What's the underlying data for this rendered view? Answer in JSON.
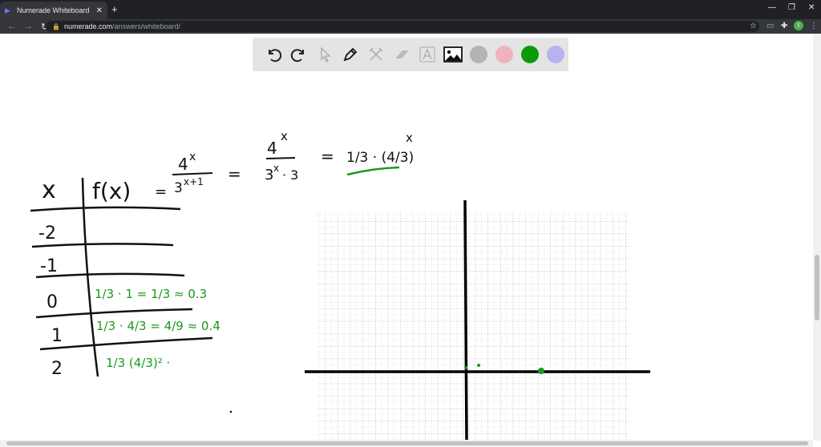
{
  "browser": {
    "tab_title": "Numerade Whiteboard",
    "url_host": "numerade.com",
    "url_path": "/answers/whiteboard/",
    "avatar_letter": "I"
  },
  "toolbar": {
    "tools": [
      "undo-icon",
      "redo-icon",
      "select-icon",
      "pen-icon",
      "tools-icon",
      "eraser-icon",
      "text-icon",
      "image-icon"
    ],
    "colors": [
      "#b3b3b3",
      "#f0b3bb",
      "#0a9a0a",
      "#b8b3ee"
    ]
  },
  "whiteboard": {
    "equation": {
      "lhs": "f(x)",
      "eq": "=",
      "frac1_num": "4",
      "frac1_num_exp": "x",
      "frac1_den": "3",
      "frac1_den_exp": "x+1",
      "frac2_num": "4",
      "frac2_num_exp": "x",
      "frac2_den": "3",
      "frac2_den_exp": "x",
      "frac2_den_tail": "· 3",
      "result": "1/3 · (4/3)",
      "result_exp": "x"
    },
    "table": {
      "header_x": "x",
      "rows": [
        {
          "x": "-2",
          "fx": ""
        },
        {
          "x": "-1",
          "fx": ""
        },
        {
          "x": "0",
          "fx": "1/3 · 1 = 1/3 ≈ 0.3"
        },
        {
          "x": "1",
          "fx": "1/3 · 4/3 = 4/9 ≈ 0.4̄"
        },
        {
          "x": "2",
          "fx": "1/3 (4/3)² ·"
        }
      ]
    },
    "accent_color": "#1a9a1a"
  }
}
